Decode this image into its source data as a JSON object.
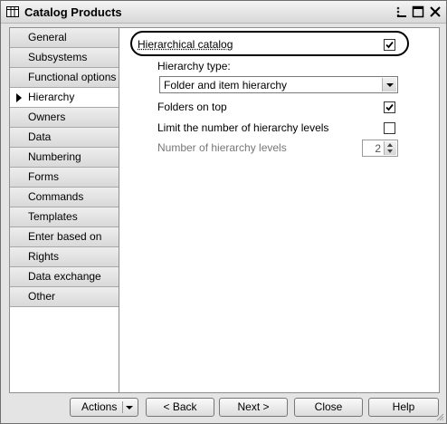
{
  "window": {
    "title": "Catalog Products",
    "title_icon": "table-grid-icon",
    "controls": [
      "more-menu-icon",
      "minimize-icon",
      "maximize-icon",
      "close-icon"
    ]
  },
  "sidebar": {
    "items": [
      {
        "label": "General",
        "active": false
      },
      {
        "label": "Subsystems",
        "active": false
      },
      {
        "label": "Functional options",
        "active": false
      },
      {
        "label": "Hierarchy",
        "active": true
      },
      {
        "label": "Owners",
        "active": false
      },
      {
        "label": "Data",
        "active": false
      },
      {
        "label": "Numbering",
        "active": false
      },
      {
        "label": "Forms",
        "active": false
      },
      {
        "label": "Commands",
        "active": false
      },
      {
        "label": "Templates",
        "active": false
      },
      {
        "label": "Enter based on",
        "active": false
      },
      {
        "label": "Rights",
        "active": false
      },
      {
        "label": "Data exchange",
        "active": false
      },
      {
        "label": "Other",
        "active": false
      }
    ]
  },
  "hierarchy": {
    "hierarchical_catalog": {
      "label": "Hierarchical catalog",
      "checked": true
    },
    "hierarchy_type": {
      "label": "Hierarchy type:",
      "value": "Folder and item hierarchy"
    },
    "folders_on_top": {
      "label": "Folders on top",
      "checked": true
    },
    "limit_levels": {
      "label": "Limit the number of hierarchy levels",
      "checked": false
    },
    "number_of_levels": {
      "label": "Number of hierarchy levels",
      "value": "2",
      "enabled": false
    }
  },
  "footer": {
    "actions": "Actions",
    "back": "< Back",
    "next": "Next >",
    "close": "Close",
    "help": "Help"
  }
}
